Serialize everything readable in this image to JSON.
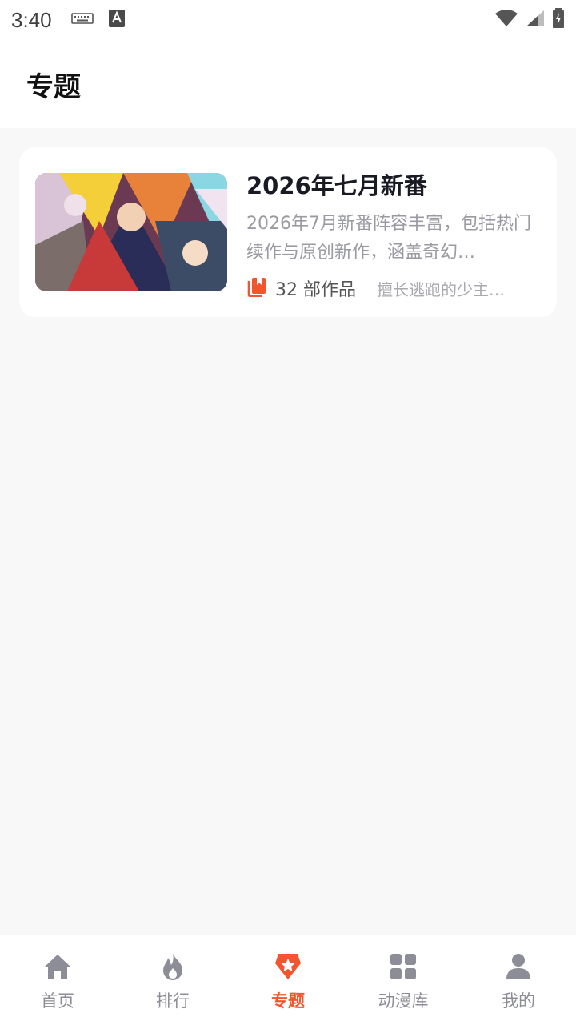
{
  "status_bar": {
    "time": "3:40"
  },
  "header": {
    "title": "专题"
  },
  "topics": [
    {
      "title": "2026年七月新番",
      "description": "2026年7月新番阵容丰富，包括热门续作与原创新作，涵盖奇幻…",
      "count_label": "32 部作品",
      "preview": "擅长逃跑的少主…"
    }
  ],
  "bottom_nav": {
    "items": [
      {
        "label": "首页",
        "icon": "home-icon"
      },
      {
        "label": "排行",
        "icon": "fire-icon"
      },
      {
        "label": "专题",
        "icon": "star-badge-icon",
        "active": true
      },
      {
        "label": "动漫库",
        "icon": "grid-icon"
      },
      {
        "label": "我的",
        "icon": "person-icon"
      }
    ]
  },
  "colors": {
    "accent": "#f1562e",
    "inactive": "#8d8d98",
    "title": "#1a1a24",
    "background": "#f8f8f8"
  }
}
